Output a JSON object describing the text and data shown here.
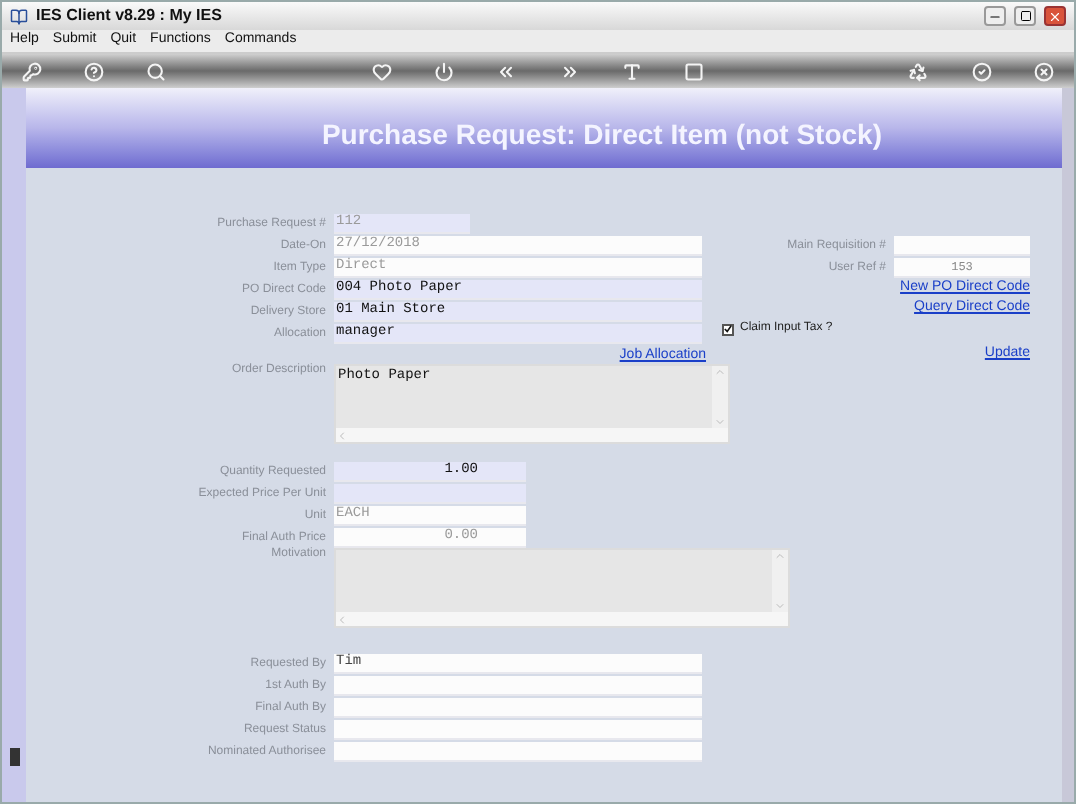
{
  "window": {
    "title": "IES Client v8.29 : My IES"
  },
  "menu": [
    "Help",
    "Submit",
    "Quit",
    "Functions",
    "Commands"
  ],
  "page_title": "Purchase Request: Direct Item (not Stock)",
  "main_fields": [
    {
      "label": "Purchase Request #",
      "value": "112",
      "kind": "lookup",
      "disabled": true
    },
    {
      "label": "Date-On",
      "value": "27/12/2018",
      "kind": "text",
      "disabled": true
    },
    {
      "label": "Item Type",
      "value": "Direct",
      "kind": "text",
      "disabled": true
    },
    {
      "label": "PO Direct Code",
      "value": "004 Photo Paper",
      "kind": "lookup",
      "disabled": false
    },
    {
      "label": "Delivery Store",
      "value": "01 Main Store",
      "kind": "lookup",
      "disabled": false
    },
    {
      "label": "Allocation",
      "value": "manager",
      "kind": "lookup",
      "disabled": false
    }
  ],
  "job_allocation_link": "Job Allocation",
  "order_description": {
    "label": "Order Description",
    "value": "Photo Paper"
  },
  "right_fields": [
    {
      "label": "Main Requisition #"
    },
    {
      "label": "User Ref #",
      "value": "153"
    }
  ],
  "right_links": [
    "New PO Direct Code",
    "Query Direct Code"
  ],
  "claim_input_tax": {
    "label": "Claim Input Tax ?",
    "checked": true
  },
  "update_link": "Update",
  "quantity_fields": [
    {
      "label": "Quantity Requested",
      "value": "1.00",
      "kind": "lookup",
      "disabled": false
    },
    {
      "label": "Expected Price Per Unit",
      "kind": "lookup"
    },
    {
      "label": "Unit",
      "value": "EACH",
      "kind": "text",
      "disabled": true
    },
    {
      "label": "Final Auth Price",
      "value": "0.00",
      "kind": "text",
      "disabled": true
    }
  ],
  "motivation": {
    "label": "Motivation"
  },
  "auth_fields": [
    {
      "label": "Requested By",
      "value": "Tim"
    },
    {
      "label": "1st Auth By"
    },
    {
      "label": "Final Auth By"
    },
    {
      "label": "Request Status"
    },
    {
      "label": "Nominated Authorisee"
    }
  ]
}
